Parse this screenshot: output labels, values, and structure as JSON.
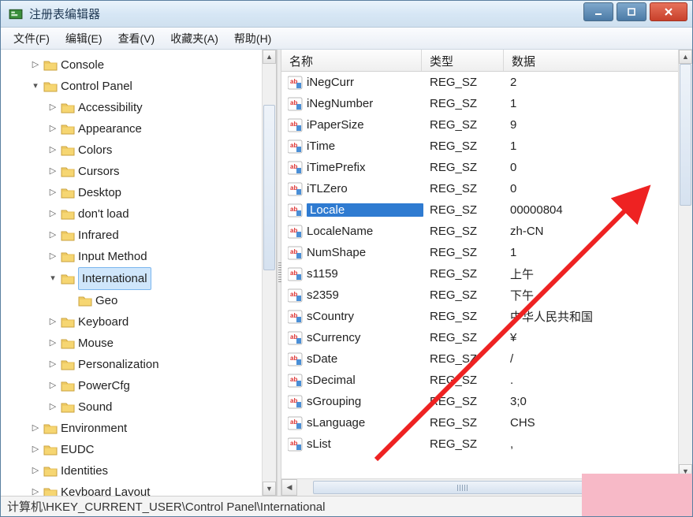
{
  "window": {
    "title": "注册表编辑器"
  },
  "menubar": [
    "文件(F)",
    "编辑(E)",
    "查看(V)",
    "收藏夹(A)",
    "帮助(H)"
  ],
  "tree": {
    "top": "Console",
    "cp_label": "Control Panel",
    "cp_children": [
      "Accessibility",
      "Appearance",
      "Colors",
      "Cursors",
      "Desktop",
      "don't load",
      "Infrared",
      "Input Method"
    ],
    "intl_label": "International",
    "intl_child": "Geo",
    "cp_children2": [
      "Keyboard",
      "Mouse",
      "Personalization",
      "PowerCfg",
      "Sound"
    ],
    "siblings_after": [
      "Environment",
      "EUDC",
      "Identities",
      "Keyboard Layout"
    ]
  },
  "columns": {
    "name": "名称",
    "type": "类型",
    "data": "数据"
  },
  "values": [
    {
      "name": "iNegCurr",
      "type": "REG_SZ",
      "data": "2"
    },
    {
      "name": "iNegNumber",
      "type": "REG_SZ",
      "data": "1"
    },
    {
      "name": "iPaperSize",
      "type": "REG_SZ",
      "data": "9"
    },
    {
      "name": "iTime",
      "type": "REG_SZ",
      "data": "1"
    },
    {
      "name": "iTimePrefix",
      "type": "REG_SZ",
      "data": "0"
    },
    {
      "name": "iTLZero",
      "type": "REG_SZ",
      "data": "0"
    },
    {
      "name": "Locale",
      "type": "REG_SZ",
      "data": "00000804",
      "selected": true
    },
    {
      "name": "LocaleName",
      "type": "REG_SZ",
      "data": "zh-CN"
    },
    {
      "name": "NumShape",
      "type": "REG_SZ",
      "data": "1"
    },
    {
      "name": "s1159",
      "type": "REG_SZ",
      "data": "上午"
    },
    {
      "name": "s2359",
      "type": "REG_SZ",
      "data": "下午"
    },
    {
      "name": "sCountry",
      "type": "REG_SZ",
      "data": "中华人民共和国"
    },
    {
      "name": "sCurrency",
      "type": "REG_SZ",
      "data": "¥"
    },
    {
      "name": "sDate",
      "type": "REG_SZ",
      "data": "/"
    },
    {
      "name": "sDecimal",
      "type": "REG_SZ",
      "data": "."
    },
    {
      "name": "sGrouping",
      "type": "REG_SZ",
      "data": "3;0"
    },
    {
      "name": "sLanguage",
      "type": "REG_SZ",
      "data": "CHS"
    },
    {
      "name": "sList",
      "type": "REG_SZ",
      "data": ","
    }
  ],
  "statusbar": "计算机\\HKEY_CURRENT_USER\\Control Panel\\International"
}
